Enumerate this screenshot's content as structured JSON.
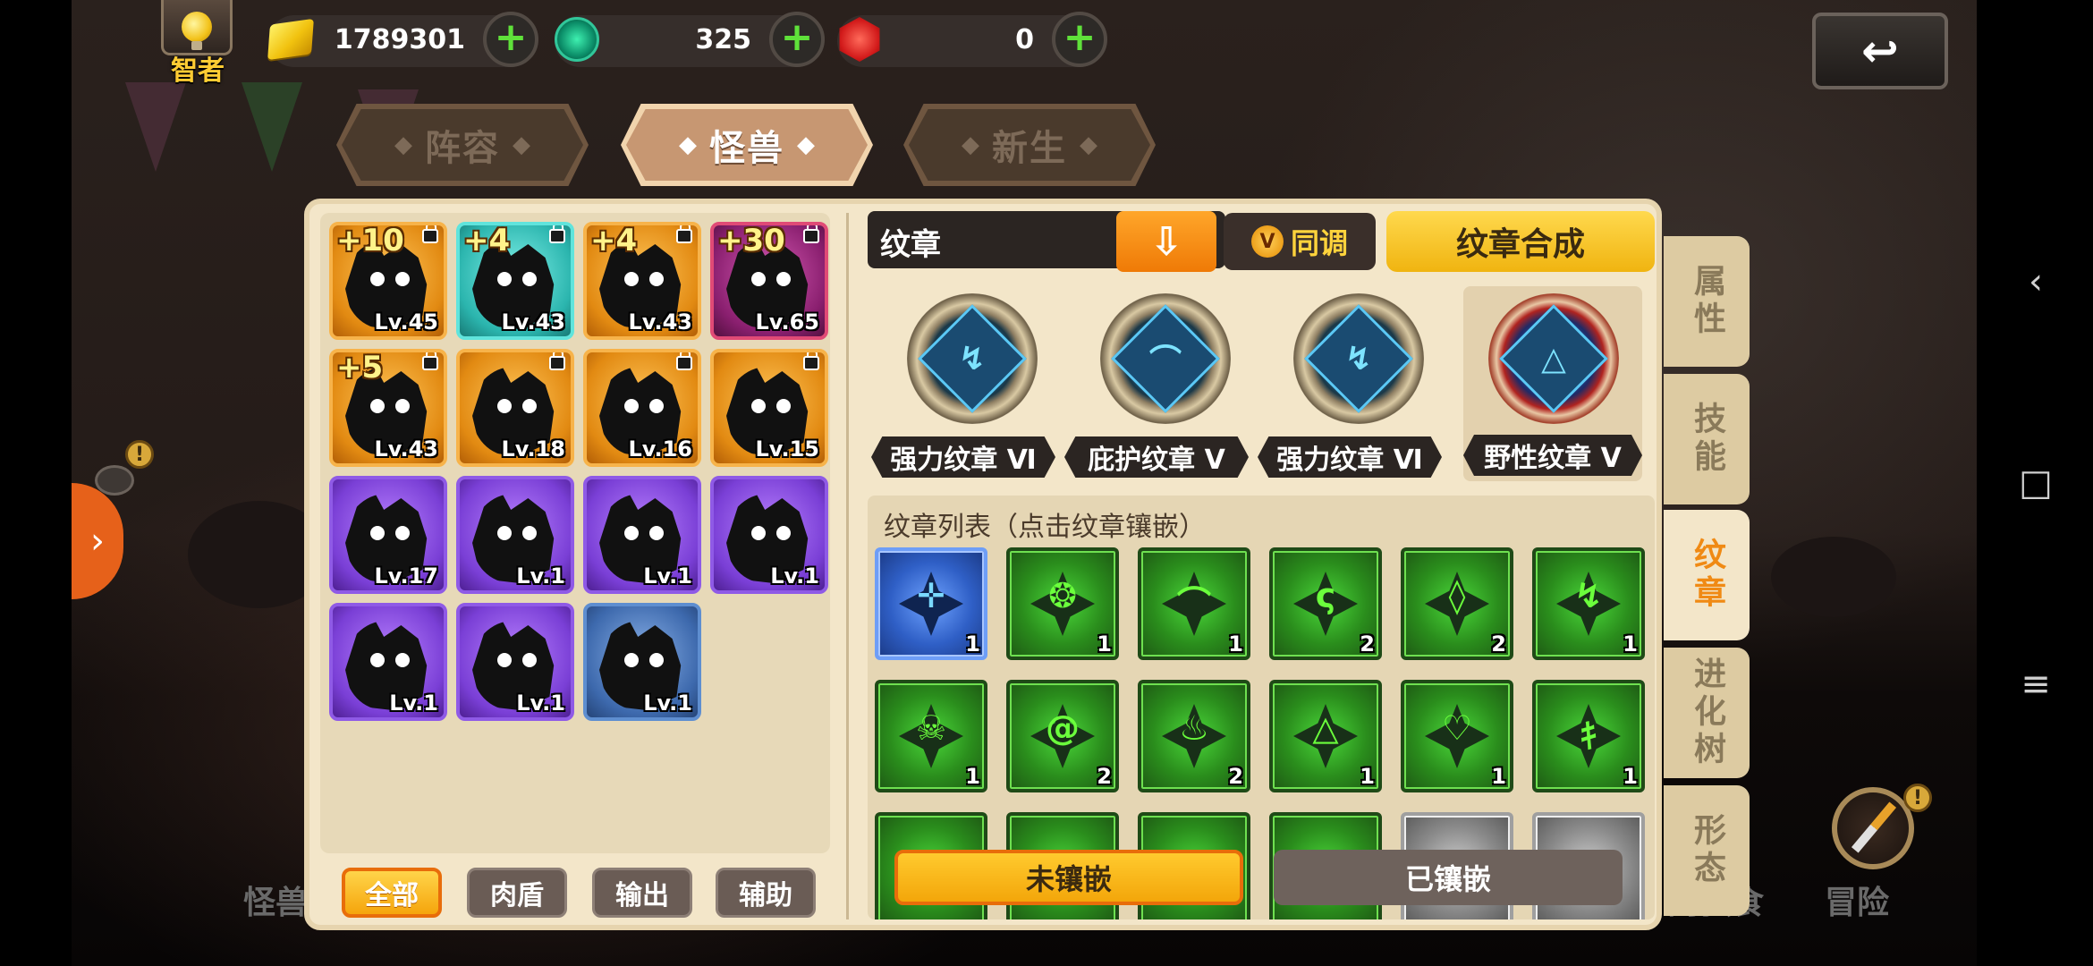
{
  "topbar": {
    "rank_label": "智者",
    "resources": [
      {
        "icon": "gold-icon",
        "value": "1789301"
      },
      {
        "icon": "green-gem-icon",
        "value": "325"
      },
      {
        "icon": "red-gem-icon",
        "value": "0"
      }
    ],
    "plus_symbol": "+",
    "back_symbol": "↩"
  },
  "tabs": [
    {
      "label": "阵容",
      "active": false
    },
    {
      "label": "怪兽",
      "active": true
    },
    {
      "label": "新生",
      "active": false
    }
  ],
  "tab_deco_left": "◆",
  "tab_deco_right": "◆",
  "roster": {
    "cards": [
      {
        "plus": "+10",
        "level": "Lv.45",
        "rarity": "orange",
        "locked": true
      },
      {
        "plus": "+4",
        "level": "Lv.43",
        "rarity": "teal",
        "locked": true
      },
      {
        "plus": "+4",
        "level": "Lv.43",
        "rarity": "orange",
        "locked": true
      },
      {
        "plus": "+30",
        "level": "Lv.65",
        "rarity": "red",
        "locked": true
      },
      {
        "plus": "+5",
        "level": "Lv.43",
        "rarity": "orange",
        "locked": true
      },
      {
        "plus": "",
        "level": "Lv.18",
        "rarity": "orange",
        "locked": true
      },
      {
        "plus": "",
        "level": "Lv.16",
        "rarity": "orange",
        "locked": true
      },
      {
        "plus": "",
        "level": "Lv.15",
        "rarity": "orange",
        "locked": true
      },
      {
        "plus": "",
        "level": "Lv.17",
        "rarity": "purple",
        "locked": false
      },
      {
        "plus": "",
        "level": "Lv.1",
        "rarity": "purple",
        "locked": false
      },
      {
        "plus": "",
        "level": "Lv.1",
        "rarity": "purple",
        "locked": false
      },
      {
        "plus": "",
        "level": "Lv.1",
        "rarity": "purple",
        "locked": false
      },
      {
        "plus": "",
        "level": "Lv.1",
        "rarity": "purple",
        "locked": false
      },
      {
        "plus": "",
        "level": "Lv.1",
        "rarity": "purple",
        "locked": false
      },
      {
        "plus": "",
        "level": "Lv.1",
        "rarity": "blue",
        "locked": false
      }
    ],
    "filters": [
      {
        "label": "全部",
        "active": true
      },
      {
        "label": "肉盾",
        "active": false
      },
      {
        "label": "输出",
        "active": false
      },
      {
        "label": "辅助",
        "active": false
      }
    ]
  },
  "emblem": {
    "title": "纹章",
    "sync_label": "同调",
    "sync_badge": "V",
    "combine_label": "纹章合成",
    "unload_symbol": "⇩",
    "slots": [
      {
        "name": "强力纹章 Ⅵ",
        "glyph": "↯"
      },
      {
        "name": "庇护纹章 Ⅴ",
        "glyph": "⌒"
      },
      {
        "name": "强力纹章 Ⅵ",
        "glyph": "↯"
      },
      {
        "name": "野性纹章 Ⅴ",
        "glyph": "△"
      }
    ],
    "list_title": "纹章列表（点击纹章镶嵌）",
    "list": [
      {
        "glyph": "✛",
        "count": "1",
        "color": "blue"
      },
      {
        "glyph": "❂",
        "count": "1",
        "color": "green"
      },
      {
        "glyph": "⌒",
        "count": "1",
        "color": "green"
      },
      {
        "glyph": "ς",
        "count": "2",
        "color": "green"
      },
      {
        "glyph": "◊",
        "count": "2",
        "color": "green"
      },
      {
        "glyph": "↯",
        "count": "1",
        "color": "green"
      },
      {
        "glyph": "☠",
        "count": "1",
        "color": "green"
      },
      {
        "glyph": "@",
        "count": "2",
        "color": "green"
      },
      {
        "glyph": "♨",
        "count": "2",
        "color": "green"
      },
      {
        "glyph": "△",
        "count": "1",
        "color": "green"
      },
      {
        "glyph": "♡",
        "count": "1",
        "color": "green"
      },
      {
        "glyph": "ｷ",
        "count": "1",
        "color": "green"
      }
    ],
    "not_inlaid_label": "未镶嵌",
    "inlaid_label": "已镶嵌"
  },
  "side_tabs": [
    {
      "label": "属性",
      "active": false
    },
    {
      "label": "技能",
      "active": false
    },
    {
      "label": "纹章",
      "active": true
    },
    {
      "label": "进化树",
      "active": false
    },
    {
      "label": "形态",
      "active": false
    }
  ],
  "bottom_nav": {
    "monster": "怪兽",
    "feast": "肉强食",
    "adventure": "冒险"
  },
  "alert_symbol": "!",
  "system_nav": {
    "back": "‹",
    "home": "□",
    "menu": "≡"
  },
  "side_arrow": "›"
}
